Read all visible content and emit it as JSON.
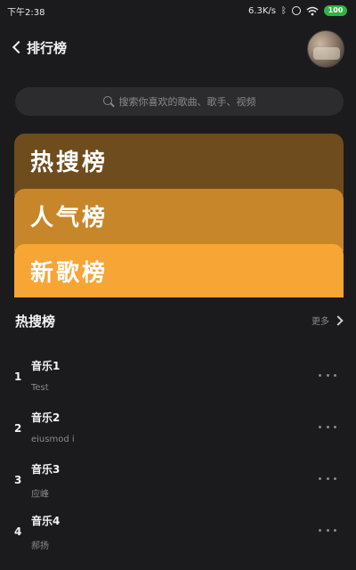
{
  "status_bar": {
    "time": "下午2:38",
    "network_speed": "6.3K/s",
    "battery_level": "100",
    "bluetooth_icon": "bluetooth-icon",
    "wifi_icon": "wifi-icon"
  },
  "header": {
    "back_icon": "chevron-left-icon",
    "title": "排行榜"
  },
  "search": {
    "icon": "search-icon",
    "placeholder": "搜索你喜欢的歌曲、歌手、视频"
  },
  "rank_cards": [
    {
      "label": "热搜榜",
      "color": "#6e4c1d"
    },
    {
      "label": "人气榜",
      "color": "#c8862a"
    },
    {
      "label": "新歌榜",
      "color": "#f7a534"
    }
  ],
  "section": {
    "title": "热搜榜",
    "more_label": "更多",
    "more_icon": "chevron-right-icon"
  },
  "songs": [
    {
      "rank": "1",
      "name": "音乐1",
      "artist": "Test"
    },
    {
      "rank": "2",
      "name": "音乐2",
      "artist": "eiusmod i"
    },
    {
      "rank": "3",
      "name": "音乐3",
      "artist": "应峰"
    },
    {
      "rank": "4",
      "name": "音乐4",
      "artist": "郝扬"
    }
  ],
  "colors": {
    "background": "#1b1b1d",
    "accent": "#f7a534"
  }
}
